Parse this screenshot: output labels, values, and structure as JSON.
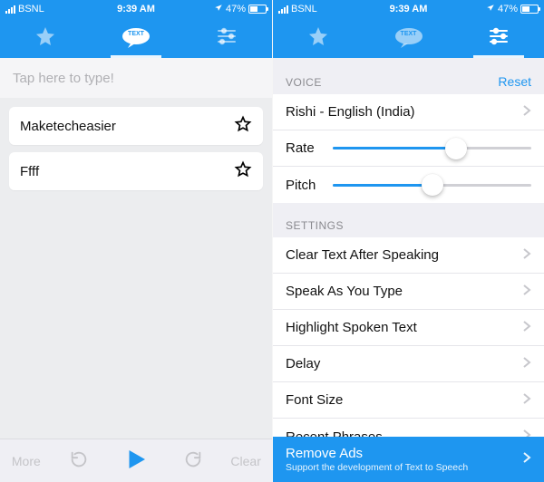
{
  "status": {
    "carrier": "BSNL",
    "time": "9:39 AM",
    "battery_pct": "47%",
    "battery_fill_pct": 47
  },
  "nav": {
    "tabs": [
      {
        "id": "favorites",
        "icon": "star-icon"
      },
      {
        "id": "text",
        "icon": "text-bubble-icon",
        "bubble_label": "TEXT"
      },
      {
        "id": "settings",
        "icon": "sliders-icon"
      }
    ]
  },
  "left_screen": {
    "active_tab_index": 1,
    "placeholder": "Tap here to type!",
    "history": [
      {
        "label": "Maketecheasier"
      },
      {
        "label": "Ffff"
      }
    ],
    "bottom": {
      "more_label": "More",
      "clear_label": "Clear"
    }
  },
  "right_screen": {
    "active_tab_index": 2,
    "voice_section_label": "VOICE",
    "reset_label": "Reset",
    "voice_name": "Rishi - English (India)",
    "rate_label": "Rate",
    "rate_value_pct": 62,
    "pitch_label": "Pitch",
    "pitch_value_pct": 50,
    "settings_section_label": "SETTINGS",
    "settings_rows": [
      "Clear Text After Speaking",
      "Speak As You Type",
      "Highlight Spoken Text",
      "Delay",
      "Font Size",
      "Recent Phrases"
    ],
    "remove_ads_title": "Remove Ads",
    "remove_ads_sub": "Support the development of Text to Speech"
  },
  "colors": {
    "accent": "#1E96F0",
    "bg_grouped": "#efeff4"
  }
}
